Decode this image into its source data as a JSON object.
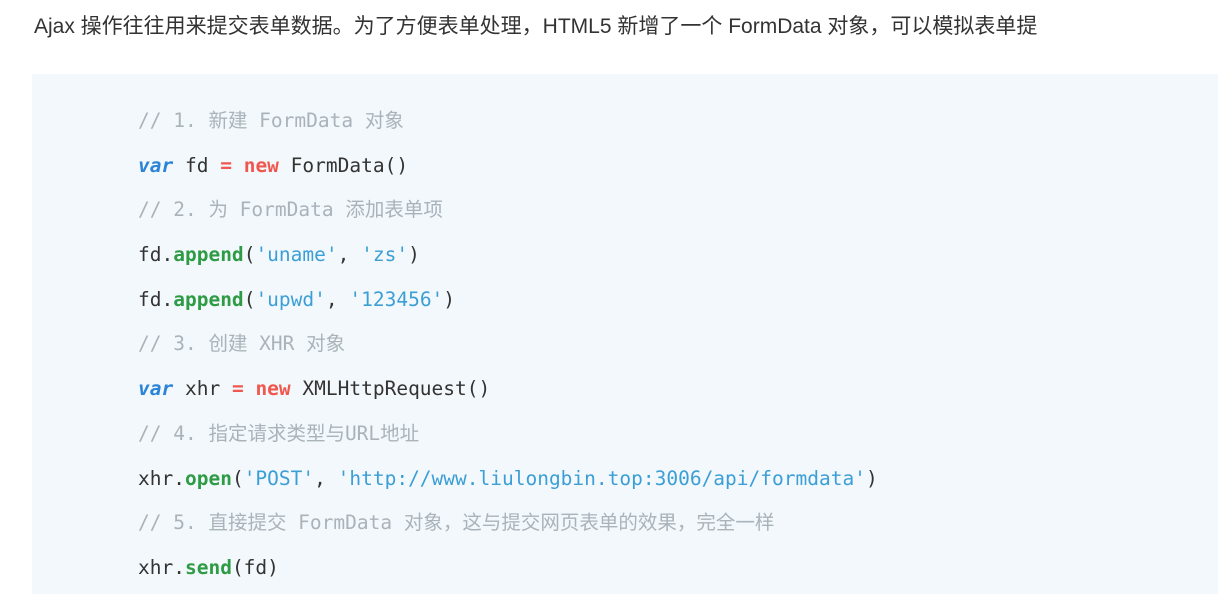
{
  "intro_text": "Ajax 操作往往用来提交表单数据。为了方便表单处理，HTML5 新增了一个 FormData 对象，可以模拟表单提",
  "code_lines": [
    [
      {
        "type": "comment",
        "text": "// 1. 新建 FormData 对象"
      }
    ],
    [
      {
        "type": "keyword",
        "text": "var"
      },
      {
        "type": "plain",
        "text": " fd "
      },
      {
        "type": "op",
        "text": "="
      },
      {
        "type": "plain",
        "text": " "
      },
      {
        "type": "new",
        "text": "new"
      },
      {
        "type": "plain",
        "text": " FormData()"
      }
    ],
    [
      {
        "type": "comment",
        "text": "// 2. 为 FormData 添加表单项"
      }
    ],
    [
      {
        "type": "plain",
        "text": "fd."
      },
      {
        "type": "method",
        "text": "append"
      },
      {
        "type": "plain",
        "text": "("
      },
      {
        "type": "string",
        "text": "'uname'"
      },
      {
        "type": "plain",
        "text": ", "
      },
      {
        "type": "string",
        "text": "'zs'"
      },
      {
        "type": "plain",
        "text": ")"
      }
    ],
    [
      {
        "type": "plain",
        "text": "fd."
      },
      {
        "type": "method",
        "text": "append"
      },
      {
        "type": "plain",
        "text": "("
      },
      {
        "type": "string",
        "text": "'upwd'"
      },
      {
        "type": "plain",
        "text": ", "
      },
      {
        "type": "string",
        "text": "'123456'"
      },
      {
        "type": "plain",
        "text": ")"
      }
    ],
    [
      {
        "type": "comment",
        "text": "// 3. 创建 XHR 对象"
      }
    ],
    [
      {
        "type": "keyword",
        "text": "var"
      },
      {
        "type": "plain",
        "text": " xhr "
      },
      {
        "type": "op",
        "text": "="
      },
      {
        "type": "plain",
        "text": " "
      },
      {
        "type": "new",
        "text": "new"
      },
      {
        "type": "plain",
        "text": " XMLHttpRequest()"
      }
    ],
    [
      {
        "type": "comment",
        "text": "// 4. 指定请求类型与URL地址"
      }
    ],
    [
      {
        "type": "plain",
        "text": "xhr."
      },
      {
        "type": "method",
        "text": "open"
      },
      {
        "type": "plain",
        "text": "("
      },
      {
        "type": "string",
        "text": "'POST'"
      },
      {
        "type": "plain",
        "text": ", "
      },
      {
        "type": "string",
        "text": "'http://www.liulongbin.top:3006/api/formdata'"
      },
      {
        "type": "plain",
        "text": ")"
      }
    ],
    [
      {
        "type": "comment",
        "text": "// 5. 直接提交 FormData 对象，这与提交网页表单的效果，完全一样"
      }
    ],
    [
      {
        "type": "plain",
        "text": "xhr."
      },
      {
        "type": "method",
        "text": "send"
      },
      {
        "type": "plain",
        "text": "(fd)"
      }
    ]
  ]
}
